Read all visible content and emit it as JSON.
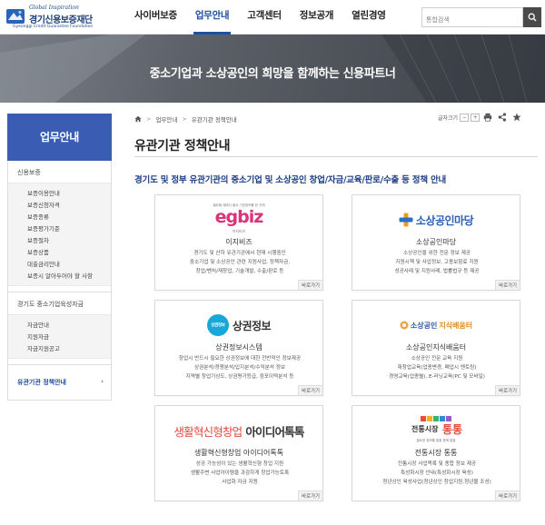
{
  "brand": {
    "tagline": "Global Inspiration",
    "name": "경기신용보증재단",
    "english": "Gyeonggi Credit Guarantee Foundation",
    "color": "#1a3f7a"
  },
  "nav": {
    "items": [
      {
        "label": "사이버보증",
        "active": false
      },
      {
        "label": "업무안내",
        "active": true
      },
      {
        "label": "고객센터",
        "active": false
      },
      {
        "label": "정보공개",
        "active": false
      },
      {
        "label": "열린경영",
        "active": false
      }
    ],
    "accent": "#1f4fa0"
  },
  "search": {
    "placeholder": "통합검색",
    "icon": "search-icon"
  },
  "banner": {
    "text": "중소기업과 소상공인의 희망을 함께하는 신용파트너"
  },
  "sidebar": {
    "title": "업무안내",
    "title_bg": "#3a5db3",
    "group1": {
      "head": "신용보증",
      "items": [
        "보증이용안내",
        "보증신청자격",
        "보증종류",
        "보증평가기준",
        "보증절차",
        "보증상품",
        "대출금리안내",
        "보증시 알아두어야 할 사항"
      ]
    },
    "group2": {
      "head": "경기도 중소기업육성자금",
      "items": [
        "자금안내",
        "지원자금",
        "자금지원공고"
      ]
    },
    "current": {
      "label": "유관기관 정책안내",
      "arrow": "›"
    }
  },
  "breadcrumb": {
    "items": [
      "업무안내",
      "유관기관 정책안내"
    ],
    "sep": ">"
  },
  "tools": {
    "label": "글자크기",
    "minus": "−",
    "plus": "+"
  },
  "page": {
    "title": "유관기관 정책안내",
    "subtitle": "경기도 및 정부 유관기관의 중소기업 및 소상공인 창업/자금/교육/판로/수출 등 정책 안내"
  },
  "cards": [
    {
      "logo_text": "egbiz",
      "logo_small": "필요할 때마다 필요 기업정보를 한 곳에",
      "logo_sub": "이지비즈",
      "name": "이지비즈",
      "desc": [
        "경기도 및 산하 유관기관에서 현재 시행중인",
        "중소기업 및 소상공인 관련 지원사업, 정책자금,",
        "창업/벤처/재창업, 기술개발, 수출/판로 등"
      ],
      "more": "바로가기"
    },
    {
      "logo_text": "소상공인마당",
      "name": "소상공인마당",
      "desc": [
        "소상공인을 위한 전문 정보 제공",
        "지원시책 및 사업정보, 고용보험료 지원",
        "성공사례 및 지원사례, 법률법규 등 제공"
      ],
      "more": "바로가기"
    },
    {
      "logo_text": "상권정보",
      "logo_badge": "상권정보",
      "name": "상권정보시스템",
      "desc": [
        "창업시 반드시 필요한 상권정보에 대한 전반적인 정보제공",
        "상권분석/경쟁분석/입지분석/수익분석 정보",
        "지역별 창업기상도, 상권평가등급, 점포이력분석 등"
      ],
      "more": "바로가기"
    },
    {
      "logo_text": "소상공인 지식배움터",
      "logo_text_a": "소상공인",
      "logo_text_b": "지식배움터",
      "name": "소상공인지식배움터",
      "desc": [
        "소상공인 전문 교육 지원",
        "재창업교육(업종변경, 폐업시 멘토링)",
        "경영교육(업종별), E-러닝교육(PC 및 모바일)"
      ],
      "more": "바로가기"
    },
    {
      "logo_text": "생활혁신형창업 아이디어톡톡",
      "logo_text_a": "생활혁신형창업",
      "logo_text_b": "아이디어톡톡",
      "name": "생활혁신형창업 아이디어톡톡",
      "desc": [
        "성공 가능성이 있는 생활혁신형 창업 지원",
        "생활주변 사업아이템을 과감하게 창업가능토록",
        "사업화 자금 지원"
      ],
      "more": "바로가기"
    },
    {
      "logo_text": "전통시장 통통",
      "logo_text_a": "전통시장",
      "logo_text_b": "통통",
      "logo_small": "필요한 정보를 통통 함께 통통",
      "name": "전통시장 통통",
      "desc": [
        "전통시장 사업목록 및 종합 정보 제공",
        "특성화시장 안내(특성화시장 육성)",
        "청년상인 육성사업(청년상인 창업지원,청년몰 조성)"
      ],
      "more": "바로가기"
    }
  ]
}
